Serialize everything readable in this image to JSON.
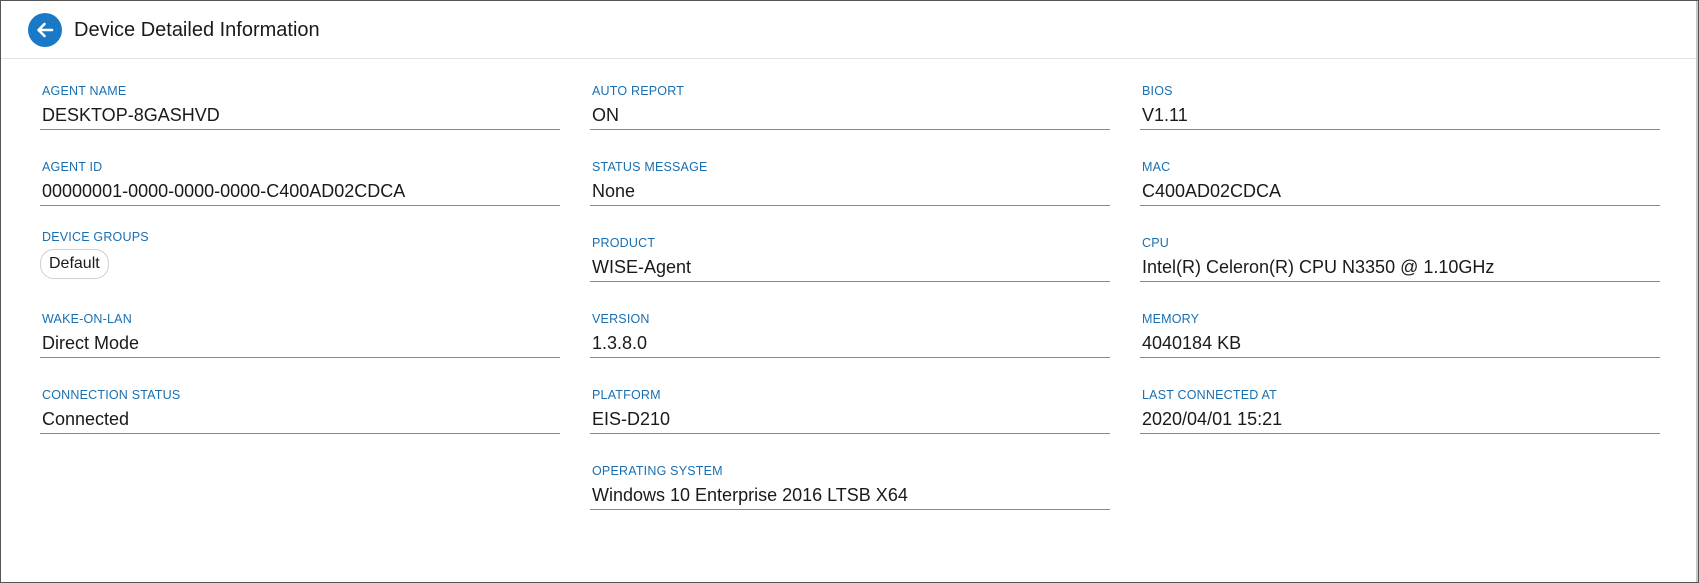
{
  "header": {
    "title": "Device Detailed Information",
    "back_icon": "arrow-left-icon"
  },
  "colors": {
    "accent": "#1a79c6",
    "label": "#1a6fb0",
    "text": "#1a1a1a",
    "underline": "#8a8a8a"
  },
  "fields": {
    "agent_name": {
      "label": "AGENT NAME",
      "value": "DESKTOP-8GASHVD"
    },
    "agent_id": {
      "label": "AGENT ID",
      "value": "00000001-0000-0000-0000-C400AD02CDCA"
    },
    "device_groups": {
      "label": "DEVICE GROUPS",
      "chips": [
        "Default"
      ]
    },
    "wake_on_lan": {
      "label": "WAKE-ON-LAN",
      "value": "Direct Mode"
    },
    "connection_status": {
      "label": "CONNECTION STATUS",
      "value": "Connected"
    },
    "auto_report": {
      "label": "AUTO REPORT",
      "value": "ON"
    },
    "status_message": {
      "label": "STATUS MESSAGE",
      "value": "None"
    },
    "product": {
      "label": "PRODUCT",
      "value": "WISE-Agent"
    },
    "version": {
      "label": "VERSION",
      "value": "1.3.8.0"
    },
    "platform": {
      "label": "PLATFORM",
      "value": "EIS-D210"
    },
    "operating_system": {
      "label": "OPERATING SYSTEM",
      "value": "Windows 10 Enterprise 2016 LTSB X64"
    },
    "bios": {
      "label": "BIOS",
      "value": "V1.11"
    },
    "mac": {
      "label": "MAC",
      "value": "C400AD02CDCA"
    },
    "cpu": {
      "label": "CPU",
      "value": "Intel(R) Celeron(R) CPU N3350 @ 1.10GHz"
    },
    "memory": {
      "label": "MEMORY",
      "value": "4040184 KB"
    },
    "last_connected_at": {
      "label": "LAST CONNECTED AT",
      "value": "2020/04/01 15:21"
    }
  }
}
